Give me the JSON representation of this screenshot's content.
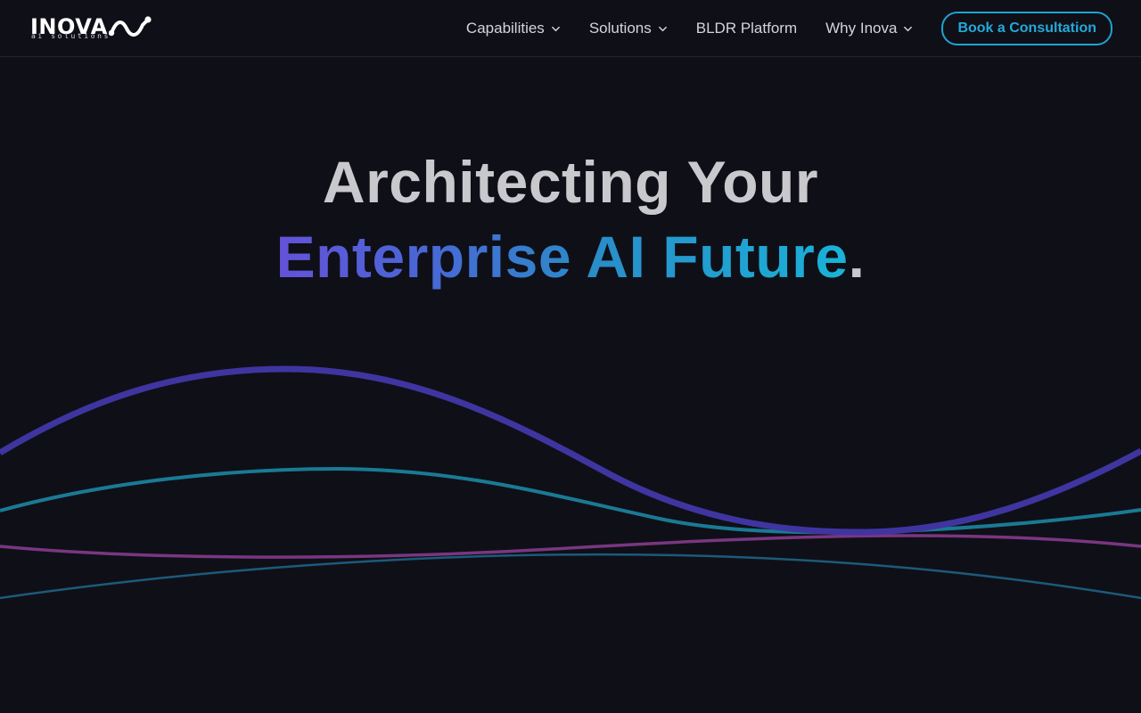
{
  "brand": {
    "name": "INOVA",
    "tagline": "ai solutions"
  },
  "nav": {
    "items": [
      {
        "label": "Capabilities",
        "icon": "chevron-down-icon"
      },
      {
        "label": "Solutions",
        "icon": "chevron-down-icon"
      },
      {
        "label": "BLDR Platform"
      },
      {
        "label": "Why Inova",
        "icon": "chevron-down-icon"
      }
    ],
    "cta_label": "Book a Consultation"
  },
  "hero": {
    "line1": "Architecting Your",
    "line2_highlight": "Enterprise AI Future",
    "line2_suffix": "."
  },
  "colors": {
    "background": "#0f0f18",
    "accent": "#22a9d8",
    "gradient_start": "#6452d8",
    "gradient_end": "#19b3d8",
    "wave_purple": "#3f35a0",
    "wave_teal": "#1a7a94",
    "wave_magenta": "#7a3680",
    "wave_blue": "#1c5a7a"
  }
}
